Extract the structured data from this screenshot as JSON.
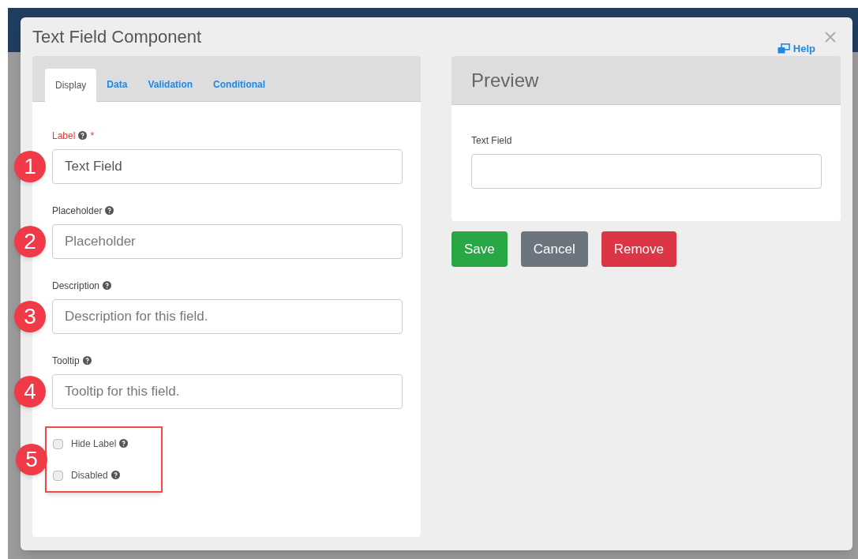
{
  "modal": {
    "title": "Text Field Component",
    "help": "Help"
  },
  "tabs": [
    {
      "label": "Display",
      "selected": true
    },
    {
      "label": "Data",
      "selected": false
    },
    {
      "label": "Validation",
      "selected": false
    },
    {
      "label": "Conditional",
      "selected": false
    }
  ],
  "fields": [
    {
      "marker": "1",
      "label": "Label",
      "required": true,
      "required_mark": "*",
      "value": "Text Field"
    },
    {
      "marker": "2",
      "label": "Placeholder",
      "required": false,
      "placeholder": "Placeholder"
    },
    {
      "marker": "3",
      "label": "Description",
      "required": false,
      "placeholder": "Description for this field."
    },
    {
      "marker": "4",
      "label": "Tooltip",
      "required": false,
      "placeholder": "Tooltip for this field."
    }
  ],
  "options": {
    "marker": "5",
    "items": [
      {
        "label": "Hide Label",
        "checked": false
      },
      {
        "label": "Disabled",
        "checked": false
      }
    ]
  },
  "preview": {
    "title": "Preview",
    "field_label": "Text Field"
  },
  "buttons": [
    {
      "label": "Save",
      "kind": "success"
    },
    {
      "label": "Cancel",
      "kind": "secondary"
    },
    {
      "label": "Remove",
      "kind": "danger"
    }
  ]
}
